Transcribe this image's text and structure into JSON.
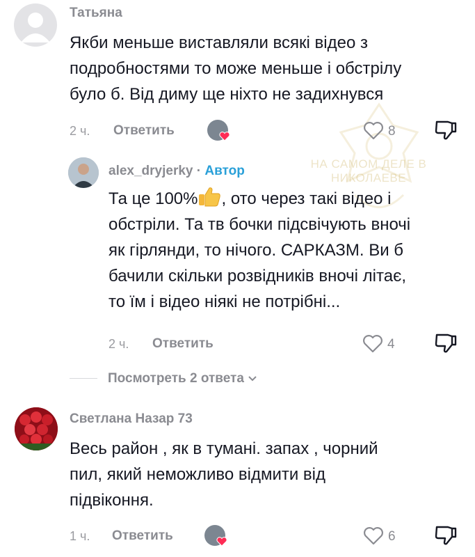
{
  "comments": [
    {
      "author": "Татьяна",
      "lines": [
        "Якби меньше виставляли всякі відео з",
        "подробностями то може меньше і обстрілу",
        "було б. Від диму ще ніхто не задихнувся"
      ],
      "time": "2 ч.",
      "reply_label": "Ответить",
      "likes": "8"
    },
    {
      "author": "alex_dryjerky",
      "author_sep": "·",
      "author_badge": "Автор",
      "line1_before": "Та це 100%",
      "line1_after": ", ото через такі відео і",
      "lines": [
        "обстріли. Та тв бочки підсвічують вночі",
        "як гірлянди, то нічого. САРКАЗМ. Ви б",
        "бачили скільки розвідників вночі літає,",
        "то їм і відео ніякі не потрібні..."
      ],
      "time": "2 ч.",
      "reply_label": "Ответить",
      "likes": "4",
      "view_replies": "Посмотреть 2 ответа"
    },
    {
      "author": "Светлана Назар 73",
      "lines": [
        "Весь район , як в тумані. запах , чорний",
        "пил, який неможливо відмити від",
        "підвіконня."
      ],
      "time": "1 ч.",
      "reply_label": "Ответить",
      "likes": "6"
    }
  ],
  "watermark": {
    "line1": "НА САМОМ ДЕЛЕ В",
    "line2": "НИКОЛАЕВЕ"
  },
  "icons": {
    "like": "heart-outline-icon",
    "dislike": "thumbs-down-icon",
    "creator_liked": "creator-liked-avatar-icon",
    "chevron": "chevron-down-icon"
  },
  "colors": {
    "author_badge": "#2aa0d8",
    "text": "#161823",
    "muted": "#8a8b91",
    "heart": "#fe2c55"
  }
}
